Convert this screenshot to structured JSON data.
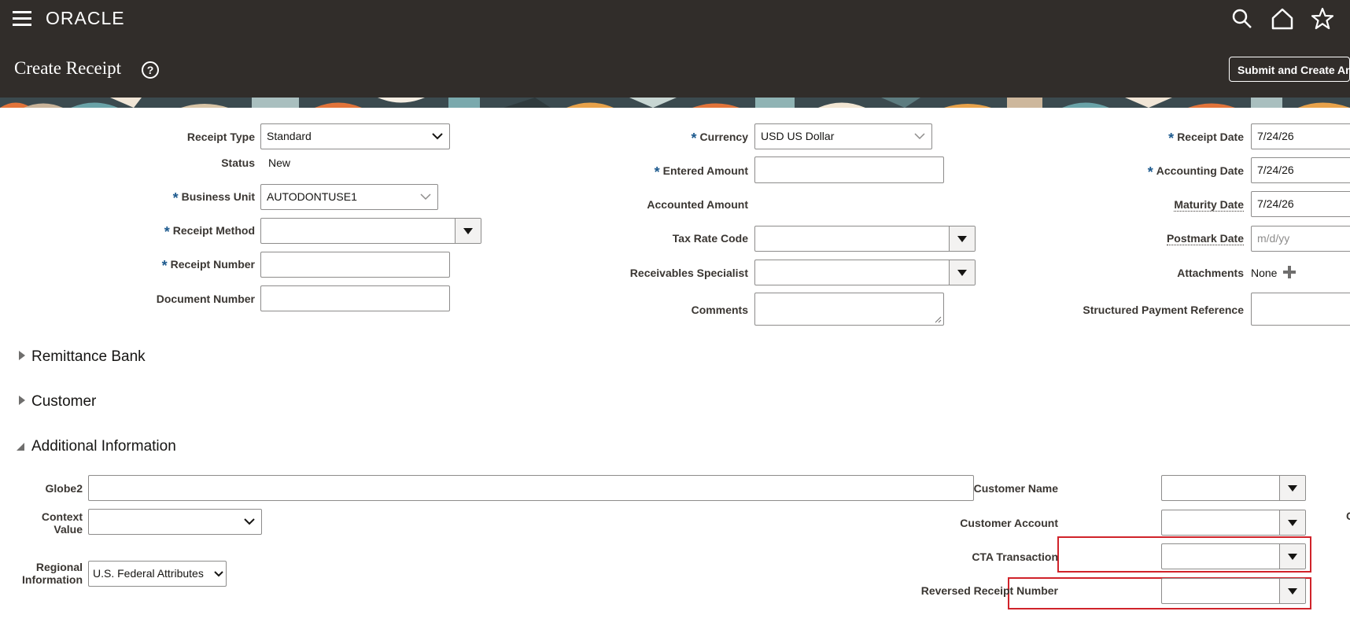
{
  "header": {
    "brand": "ORACLE",
    "page_title": "Create Receipt",
    "help_icon": "help-icon",
    "submit_label": "Submit and Create Another",
    "icons": [
      "menu-icon",
      "search-icon",
      "home-icon",
      "star-icon"
    ]
  },
  "colors": {
    "header_bg": "#312d2a",
    "required_marker": "#1d5a8e",
    "highlight_box": "#d0232a"
  },
  "form": {
    "receipt_type": {
      "label": "Receipt Type",
      "value": "Standard"
    },
    "status": {
      "label": "Status",
      "value": "New"
    },
    "business_unit": {
      "label": "Business Unit",
      "value": "AUTODONTUSE1"
    },
    "receipt_method": {
      "label": "Receipt Method",
      "value": ""
    },
    "receipt_number": {
      "label": "Receipt Number",
      "value": ""
    },
    "document_number": {
      "label": "Document Number",
      "value": ""
    },
    "currency": {
      "label": "Currency",
      "value": "USD US Dollar"
    },
    "entered_amount": {
      "label": "Entered Amount",
      "value": ""
    },
    "accounted_amount": {
      "label": "Accounted Amount",
      "value": ""
    },
    "tax_rate_code": {
      "label": "Tax Rate Code",
      "value": ""
    },
    "receivables_specialist": {
      "label": "Receivables Specialist",
      "value": ""
    },
    "comments": {
      "label": "Comments",
      "value": ""
    },
    "receipt_date": {
      "label": "Receipt Date",
      "value": "7/24/26"
    },
    "accounting_date": {
      "label": "Accounting Date",
      "value": "7/24/26"
    },
    "maturity_date": {
      "label": "Maturity Date",
      "value": "7/24/26"
    },
    "postmark_date": {
      "label": "Postmark Date",
      "value": "",
      "placeholder": "m/d/yy"
    },
    "attachments": {
      "label": "Attachments",
      "value": "None"
    },
    "structured_payment_reference": {
      "label": "Structured Payment Reference",
      "value": ""
    }
  },
  "sections": {
    "remittance_bank": "Remittance Bank",
    "customer": "Customer",
    "additional_information": "Additional Information"
  },
  "additional": {
    "globe2": {
      "label": "Globe2",
      "value": ""
    },
    "context_value": {
      "label_line1": "Context",
      "label_line2": "Value",
      "value": ""
    },
    "regional_information": {
      "label_line1": "Regional",
      "label_line2": "Information",
      "value": "U.S. Federal Attributes"
    },
    "customer_name": {
      "label": "Customer Name",
      "value": ""
    },
    "customer_account": {
      "label": "Customer Account",
      "value": ""
    },
    "cta_transaction": {
      "label": "CTA Transaction",
      "value": ""
    },
    "reversed_receipt_number": {
      "label": "Reversed Receipt Number",
      "value": ""
    },
    "edge_letter": "C"
  }
}
